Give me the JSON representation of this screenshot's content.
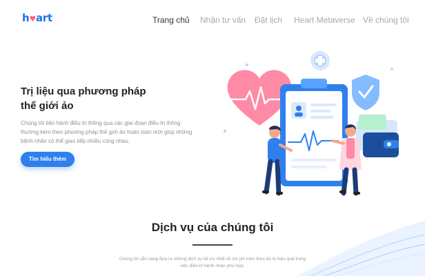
{
  "brand": {
    "logo_prefix": "h",
    "logo_heart": "♥",
    "logo_suffix": "art",
    "color": "#1f72ea",
    "heart_color": "#ff5f7e"
  },
  "nav": {
    "items": [
      {
        "label": "Trang chủ",
        "active": true
      },
      {
        "label": "Nhận tư vấn",
        "active": false
      },
      {
        "label": "Đặt lịch",
        "active": false
      },
      {
        "label": "Heart Metaverse",
        "active": false
      },
      {
        "label": "Về chúng tôi",
        "active": false
      }
    ]
  },
  "hero": {
    "title_line1": "Trị liệu qua phương pháp",
    "title_line2": "thế giới ảo",
    "description": "Chúng tôi tiến hành điều trị thông qua các giai đoạn điều trị thông thường kèm theo phương pháp thế giới ảo hoàn toàn mới giúp những bệnh nhân có thể giao tiếp nhiều cùng nhau.",
    "cta_label": "Tìm hiểu thêm",
    "cta_color": "#2f80ed"
  },
  "illustration": {
    "icons": [
      "heart-icon",
      "plus-icon",
      "shield-check-icon",
      "clipboard-icon",
      "wallet-icon"
    ]
  },
  "services": {
    "title": "Dịch vụ của chúng tôi",
    "description": "Chúng tôi sẵn sàng đưa ra những dịch vụ tối ưu nhất về chi phí kèm theo đó là hiệu quả trong việc điều trị bệnh nhân phù hợp."
  }
}
